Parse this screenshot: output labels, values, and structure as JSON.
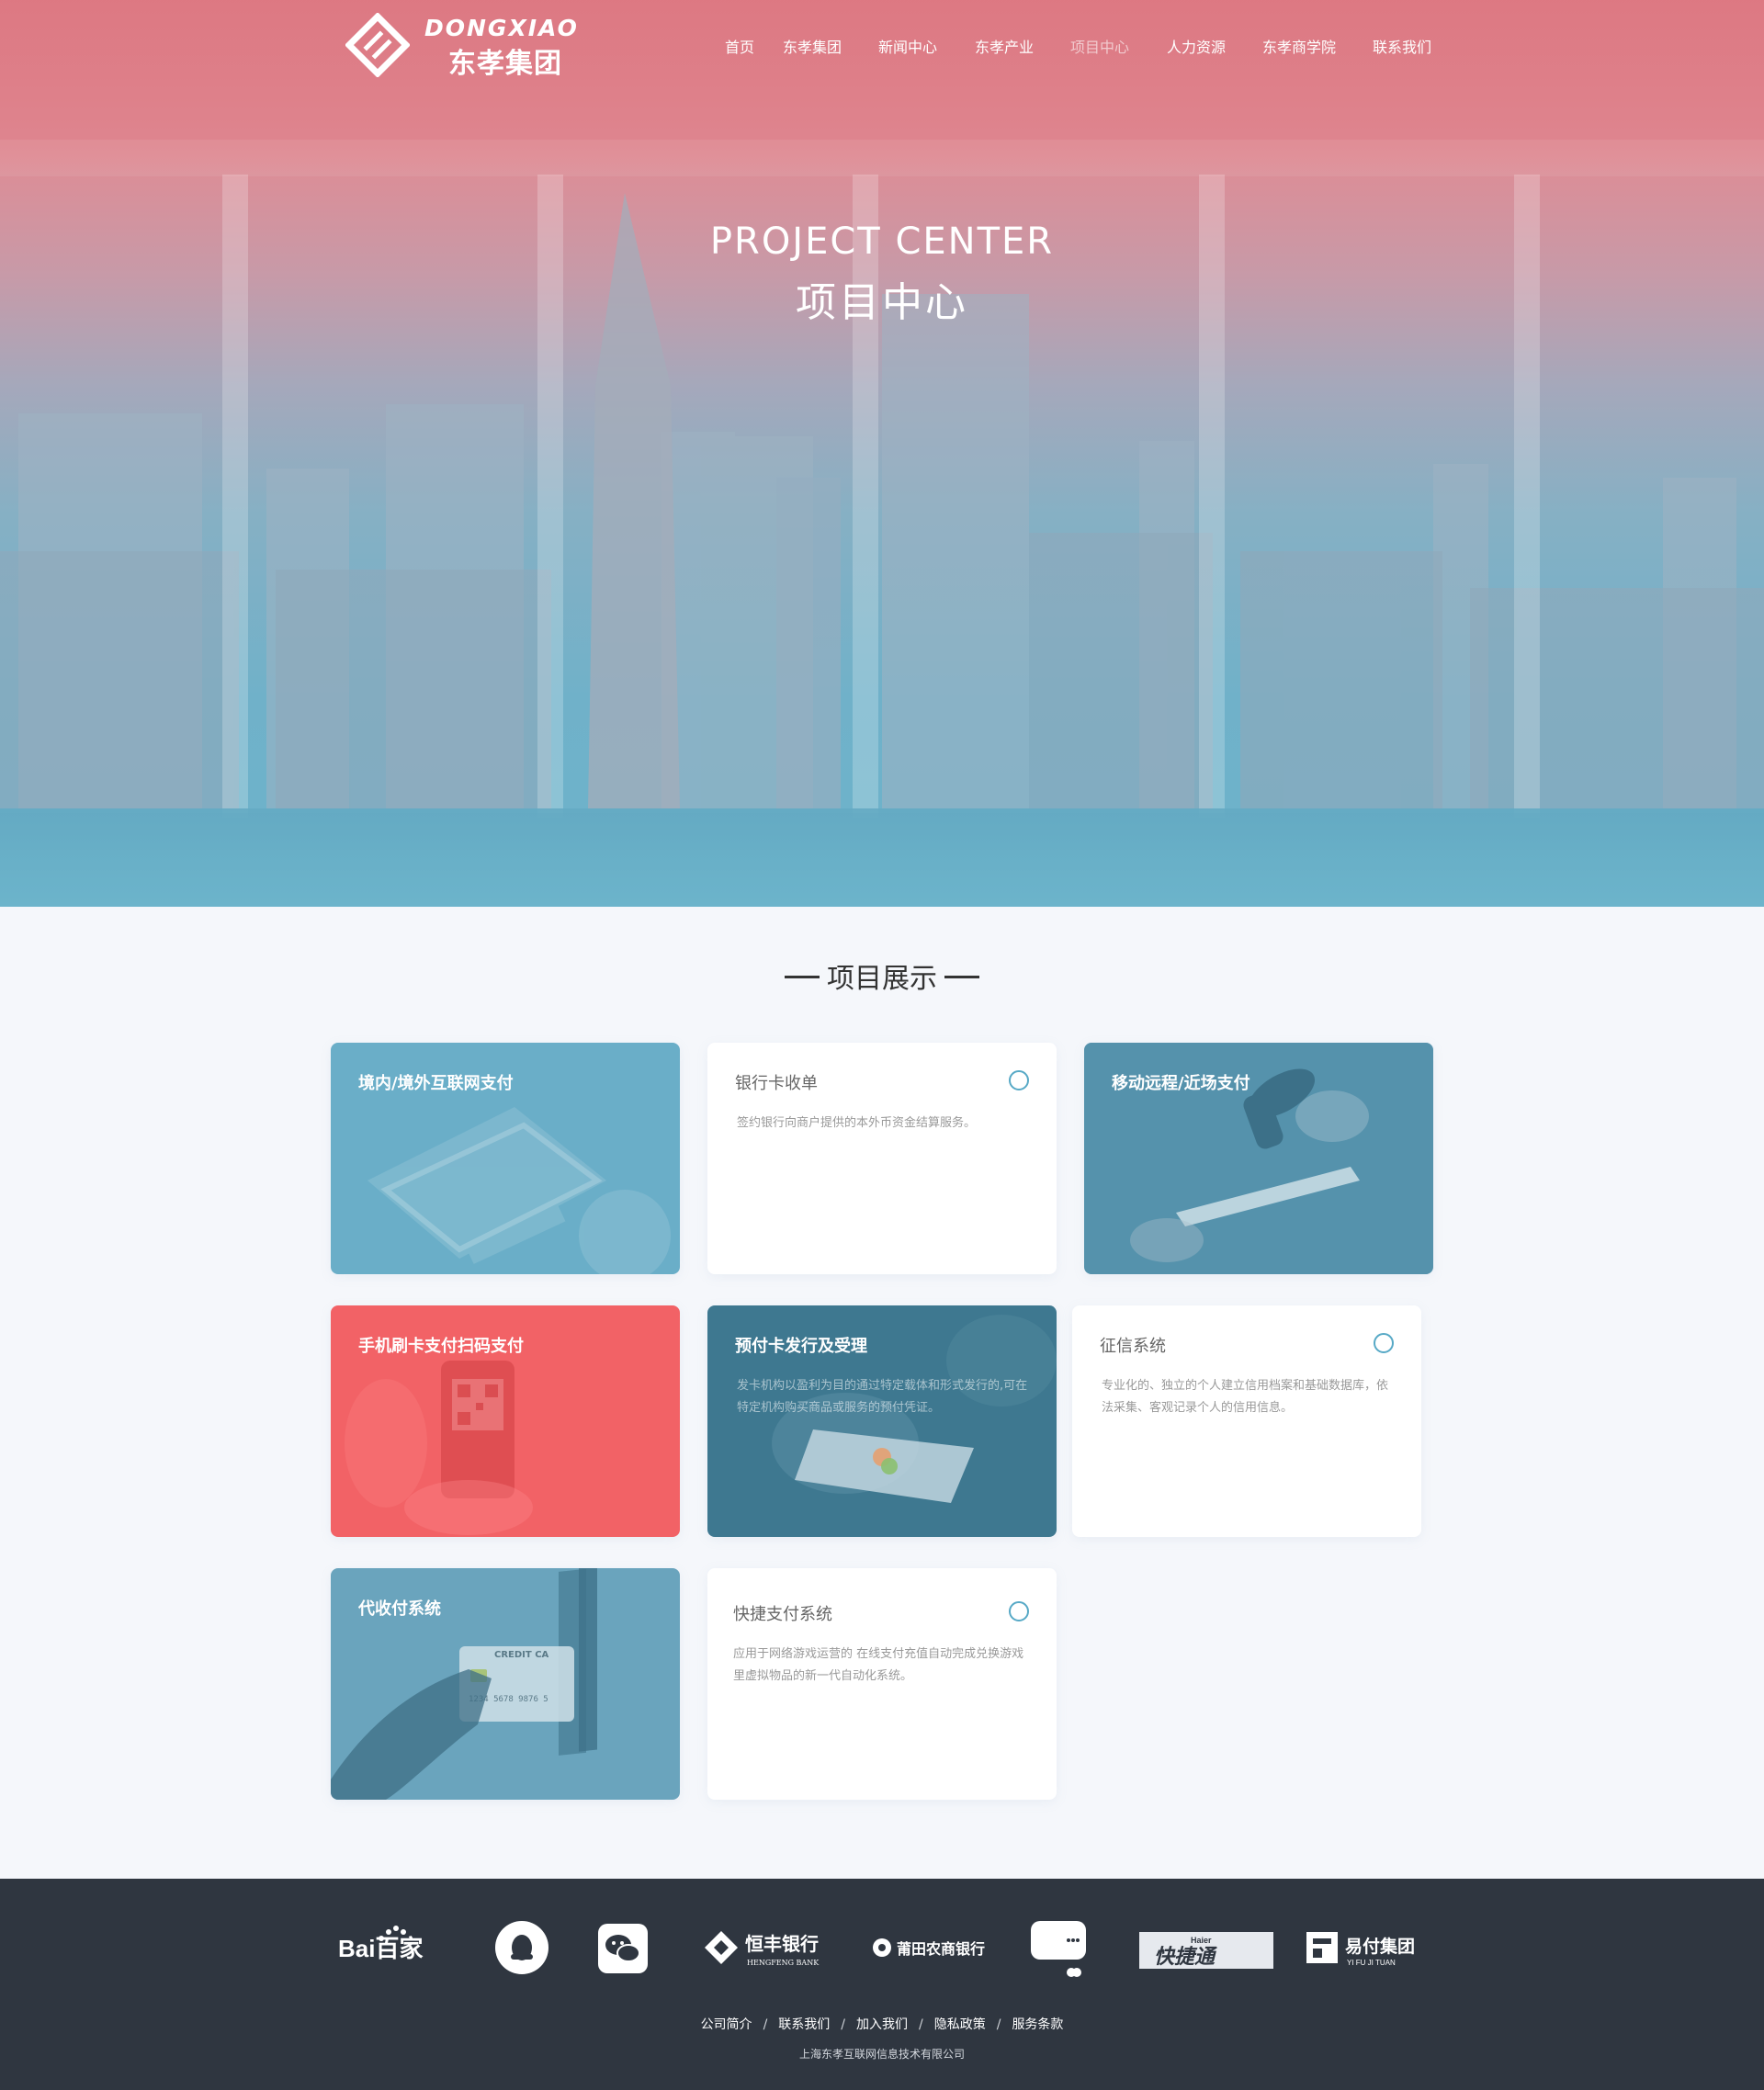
{
  "logo": {
    "en": "DONGXIAO",
    "cn": "东孝集团"
  },
  "nav": {
    "items": [
      {
        "label": "首页"
      },
      {
        "label": "东孝集团"
      },
      {
        "label": "新闻中心"
      },
      {
        "label": "东孝产业"
      },
      {
        "label": "项目中心",
        "active": true
      },
      {
        "label": "人力资源"
      },
      {
        "label": "东孝商学院"
      },
      {
        "label": "联系我们"
      }
    ]
  },
  "hero": {
    "title_en": "PROJECT CENTER",
    "title_cn": "项目中心"
  },
  "section": {
    "title": "项目展示"
  },
  "cards": [
    {
      "title": "境内/境外互联网支付",
      "desc": "",
      "style": "image-blue"
    },
    {
      "title": "银行卡收单",
      "desc": "签约银行向商户提供的本外币资金结算服务。",
      "style": "white"
    },
    {
      "title": "移动远程/近场支付",
      "desc": "",
      "style": "image-blue"
    },
    {
      "title": "手机刷卡支付扫码支付",
      "desc": "",
      "style": "image-red"
    },
    {
      "title": "预付卡发行及受理",
      "desc": "发卡机构以盈利为目的通过特定载体和形式发行的,可在特定机构购买商品或服务的预付凭证。",
      "style": "image-dark"
    },
    {
      "title": "征信系统",
      "desc": "专业化的、独立的个人建立信用档案和基础数据库，依法采集、客观记录个人的信用信息。",
      "style": "white"
    },
    {
      "title": "代收付系统",
      "desc": "",
      "style": "image-blue"
    },
    {
      "title": "快捷支付系统",
      "desc": "应用于网络游戏运营的 在线支付充值自动完成兑换游戏里虚拟物品的新一代自动化系统。",
      "style": "white"
    }
  ],
  "partners": [
    {
      "name": "Bai百家"
    },
    {
      "name": "qq-icon"
    },
    {
      "name": "wechat-icon"
    },
    {
      "name": "恒丰银行",
      "sub": "HENGFENG BANK"
    },
    {
      "name": "莆田农商银行"
    },
    {
      "name": "chat-app-icon"
    },
    {
      "name": "快捷通",
      "top": "Haier"
    },
    {
      "name": "易付集团",
      "sub": "YI FU JI TUAN"
    }
  ],
  "footer": {
    "links": [
      "公司简介",
      "联系我们",
      "加入我们",
      "隐私政策",
      "服务条款"
    ],
    "company": "上海东孝互联网信息技术有限公司"
  },
  "colors": {
    "hero_top": "#dd7d87",
    "hero_bottom": "#6cb3cb",
    "card_blue": "#6aaec8",
    "card_red": "#f26266",
    "card_dark": "#3e7890",
    "circle_accent": "#57a9c6",
    "footer_bg": "#2f3640"
  }
}
